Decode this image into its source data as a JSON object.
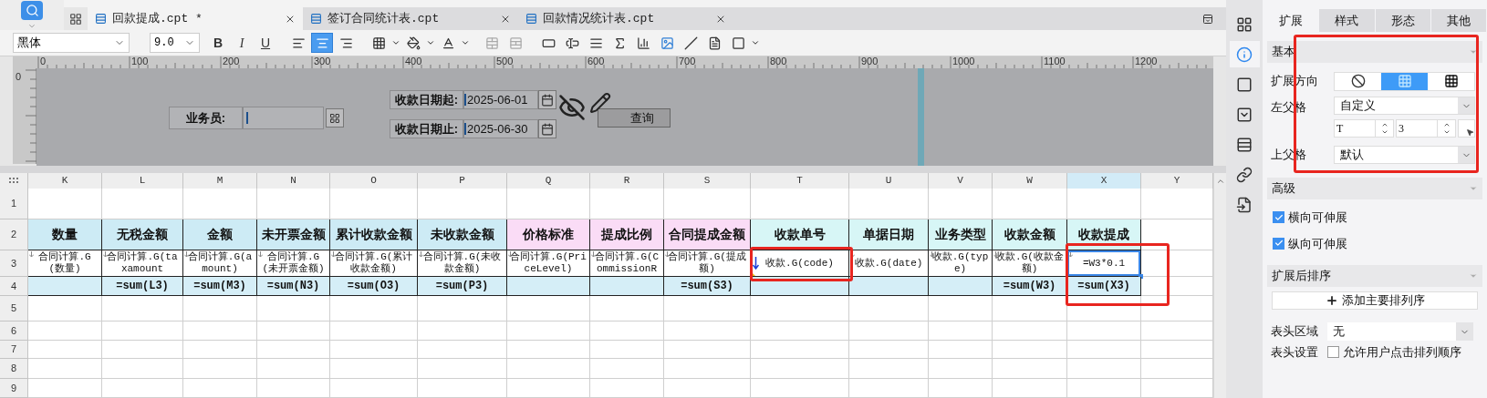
{
  "tabs": [
    {
      "label": "回款提成.cpt *",
      "selected": true
    },
    {
      "label": "签订合同统计表.cpt",
      "selected": false
    },
    {
      "label": "回款情况统计表.cpt",
      "selected": false
    }
  ],
  "toolbar": {
    "font": "黑体",
    "size": "9.0",
    "format_buttons": [
      {
        "label": "B",
        "on": false
      },
      {
        "label": "I",
        "on": false
      },
      {
        "label": "U",
        "on": false
      }
    ],
    "alignment": [
      {
        "selected": false
      },
      {
        "selected": true
      },
      {
        "selected": false
      }
    ]
  },
  "parameter_panel": {
    "ruler_labels": [
      "0",
      "100",
      "200",
      "300",
      "400",
      "500",
      "600",
      "700",
      "800",
      "900",
      "1000",
      "1100",
      "1200"
    ],
    "vertical_ruler_label": "0",
    "fields": [
      {
        "label": "业务员:",
        "kind": "picker"
      },
      {
        "label": "收款日期起:",
        "kind": "date",
        "value": "2025-06-01"
      },
      {
        "label": "收款日期止:",
        "kind": "date",
        "value": "2025-06-30"
      }
    ],
    "button": "查询"
  },
  "grid": {
    "columns": [
      {
        "label": "K",
        "selected": false
      },
      {
        "label": "L",
        "selected": false
      },
      {
        "label": "M",
        "selected": false
      },
      {
        "label": "N",
        "selected": false
      },
      {
        "label": "O",
        "selected": false
      },
      {
        "label": "P",
        "selected": false
      },
      {
        "label": "Q",
        "selected": false
      },
      {
        "label": "R",
        "selected": false
      },
      {
        "label": "S",
        "selected": false
      },
      {
        "label": "T",
        "selected": false
      },
      {
        "label": "U",
        "selected": false
      },
      {
        "label": "V",
        "selected": false
      },
      {
        "label": "W",
        "selected": false
      },
      {
        "label": "X",
        "selected": true
      },
      {
        "label": "Y",
        "selected": false
      }
    ],
    "rows": [
      {
        "number": "1",
        "kind": "blank"
      },
      {
        "number": "2",
        "kind": "header",
        "cells": [
          {
            "text": "数量",
            "color": "#cdebf5",
            "selected": false
          },
          {
            "text": "无税金额",
            "color": "#cdebf5",
            "selected": false
          },
          {
            "text": "金额",
            "color": "#cdebf5",
            "selected": false
          },
          {
            "text": "未开票金额",
            "color": "#cdebf5",
            "selected": false
          },
          {
            "text": "累计收款金额",
            "color": "#cdebf5",
            "selected": false
          },
          {
            "text": "未收款金额",
            "color": "#cdebf5",
            "selected": false
          },
          {
            "text": "价格标准",
            "color": "#fadcf6",
            "selected": false
          },
          {
            "text": "提成比例",
            "color": "#fadcf6",
            "selected": false
          },
          {
            "text": "合同提成金额",
            "color": "#fadcf6",
            "selected": false
          },
          {
            "text": "收款单号",
            "color": "#d7f6f6",
            "selected": false
          },
          {
            "text": "单据日期",
            "color": "#d7f6f6",
            "selected": false
          },
          {
            "text": "业务类型",
            "color": "#d7f6f6",
            "selected": false
          },
          {
            "text": "收款金额",
            "color": "#d7f6f6",
            "selected": false
          },
          {
            "text": "收款提成",
            "color": "#d7f6f6",
            "selected": false
          }
        ]
      },
      {
        "number": "3",
        "kind": "data",
        "cells": [
          {
            "text": "合同计算.G(数量)",
            "kind": "small",
            "selected": false
          },
          {
            "text": "合同计算.G(taxamount",
            "kind": "small",
            "selected": false
          },
          {
            "text": "合同计算.G(amount)",
            "kind": "small",
            "selected": false
          },
          {
            "text": "合同计算.G(未开票金额)",
            "kind": "small",
            "selected": false
          },
          {
            "text": "合同计算.G(累计收款金额)",
            "kind": "small",
            "selected": false
          },
          {
            "text": "合同计算.G(未收款金额)",
            "kind": "small",
            "selected": false
          },
          {
            "text": "合同计算.G(PriceLevel)",
            "kind": "small",
            "selected": false
          },
          {
            "text": "合同计算.G(CommissionR",
            "kind": "small",
            "selected": false
          },
          {
            "text": "合同计算.G(提成额)",
            "kind": "small",
            "selected": false
          },
          {
            "text": "收款.G(code)",
            "kind": "arrow",
            "selected": false
          },
          {
            "text": "收款.G(date)",
            "kind": "small",
            "selected": false
          },
          {
            "text": "收款.G(type)",
            "kind": "small",
            "selected": false
          },
          {
            "text": "收款.G(收款金额)",
            "kind": "small",
            "selected": false
          },
          {
            "text": "=W3*0.1",
            "kind": "small",
            "selected": true
          }
        ]
      },
      {
        "number": "4",
        "kind": "total",
        "cells": [
          {
            "selected": false
          },
          {
            "text": "=sum(L3)",
            "selected": false
          },
          {
            "text": "=sum(M3)",
            "selected": false
          },
          {
            "text": "=sum(N3)",
            "selected": false
          },
          {
            "text": "=sum(O3)",
            "selected": false
          },
          {
            "text": "=sum(P3)",
            "selected": false
          },
          {
            "selected": false
          },
          {
            "selected": false
          },
          {
            "text": "=sum(S3)",
            "selected": false
          },
          {
            "selected": false
          },
          {
            "selected": false
          },
          {
            "selected": false
          },
          {
            "text": "=sum(W3)",
            "selected": false
          },
          {
            "text": "=sum(X3)",
            "selected": false
          }
        ]
      },
      {
        "number": "5",
        "kind": "blank"
      },
      {
        "number": "6",
        "kind": "blank"
      },
      {
        "number": "7",
        "kind": "blank"
      },
      {
        "number": "8",
        "kind": "blank"
      },
      {
        "number": "9",
        "kind": "blank"
      }
    ]
  },
  "side_tools": [
    {
      "selected": false
    },
    {
      "selected": true
    },
    {
      "selected": false
    },
    {
      "selected": false
    },
    {
      "selected": false
    },
    {
      "selected": false
    },
    {
      "selected": false
    }
  ],
  "properties": {
    "tabs": [
      {
        "label": "扩展",
        "selected": true
      },
      {
        "label": "样式",
        "selected": false
      },
      {
        "label": "形态",
        "selected": false
      },
      {
        "label": "其他",
        "selected": false
      }
    ],
    "basic": {
      "title": "基本",
      "direction": {
        "label": "扩展方向",
        "options": [
          {
            "kind": "none",
            "selected": false
          },
          {
            "kind": "vertical",
            "selected": true
          },
          {
            "kind": "horizontal",
            "selected": false
          }
        ]
      },
      "left_parent": {
        "label": "左父格",
        "value": "自定义",
        "column": "T",
        "row": "3"
      },
      "top_parent": {
        "label": "上父格",
        "value": "默认"
      }
    },
    "advanced": {
      "title": "高级",
      "options": [
        {
          "label": "横向可伸展",
          "checked": true
        },
        {
          "label": "纵向可伸展",
          "checked": true
        }
      ]
    },
    "sorting": {
      "title": "扩展后排序",
      "button": "添加主要排列序"
    },
    "header_area": {
      "label": "表头区域",
      "value": "无"
    },
    "header_setting": {
      "label": "表头设置",
      "option": {
        "label": "允许用户点击排列顺序",
        "checked": false
      }
    }
  }
}
